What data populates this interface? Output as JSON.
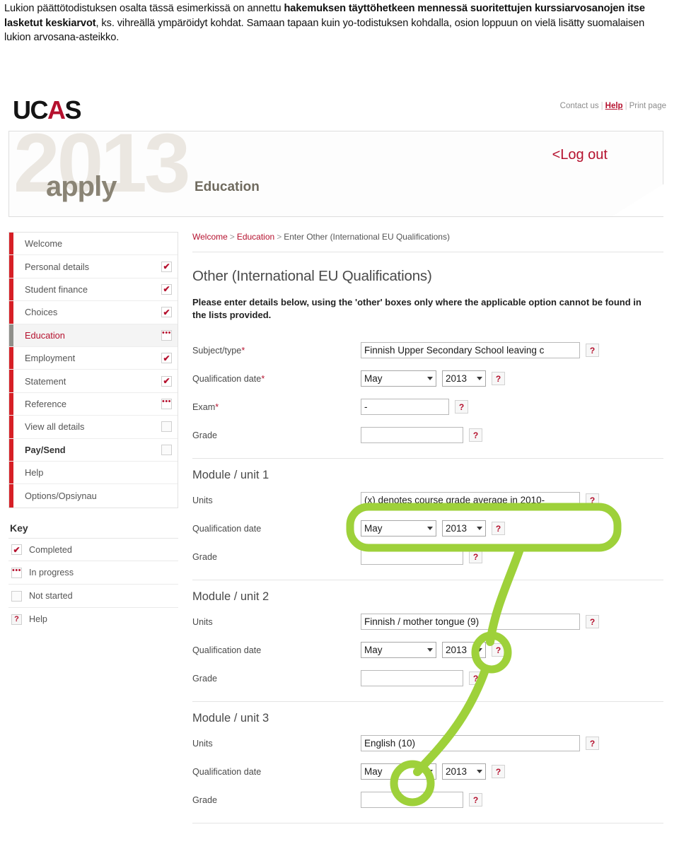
{
  "intro": {
    "segments": [
      {
        "text": "Lukion päättötodistuksen osalta tässä esimerkissä on annettu ",
        "bold": false
      },
      {
        "text": "hakemuksen täyttöhetkeen mennessä suoritettujen kurssiarvosanojen itse lasketut keskiarvot",
        "bold": true
      },
      {
        "text": ", ks. vihreällä ympäröidyt kohdat. Samaan tapaan kuin yo-todistuksen kohdalla, osion loppuun on vielä lisätty suomalaisen lukion arvosana-asteikko.",
        "bold": false
      }
    ],
    "full_text": "Lukion päättötodistuksen osalta tässä esimerkissä on annettu hakemuksen täyttöhetkeen mennessä suoritettujen kurssiarvosanojen itse lasketut keskiarvot, ks. vihreällä ympäröidyt kohdat. Samaan tapaan kuin yo-todistuksen kohdalla, osion loppuun on vielä lisätty suomalaisen lukion arvosana-asteikko."
  },
  "brand": {
    "logo_prefix": "UC",
    "logo_accent": "A",
    "logo_suffix": "S",
    "accent_color": "#b5112e"
  },
  "toplinks": {
    "contact": "Contact us",
    "help": "Help",
    "print": "Print page",
    "separator": "|"
  },
  "banner": {
    "year": "2013",
    "apply": "apply",
    "section": "Education",
    "logout": "<Log out"
  },
  "sidebar": {
    "items": [
      {
        "label": "Welcome",
        "status": "none",
        "active": false,
        "bold": false
      },
      {
        "label": "Personal details",
        "status": "completed",
        "active": false,
        "bold": false
      },
      {
        "label": "Student finance",
        "status": "completed",
        "active": false,
        "bold": false
      },
      {
        "label": "Choices",
        "status": "completed",
        "active": false,
        "bold": false
      },
      {
        "label": "Education",
        "status": "in-progress",
        "active": true,
        "bold": false
      },
      {
        "label": "Employment",
        "status": "completed",
        "active": false,
        "bold": false
      },
      {
        "label": "Statement",
        "status": "completed",
        "active": false,
        "bold": false
      },
      {
        "label": "Reference",
        "status": "in-progress",
        "active": false,
        "bold": false
      },
      {
        "label": "View all details",
        "status": "not-started",
        "active": false,
        "bold": false
      },
      {
        "label": "Pay/Send",
        "status": "not-started",
        "active": false,
        "bold": true
      },
      {
        "label": "Help",
        "status": "none",
        "active": false,
        "bold": false
      },
      {
        "label": "Options/Opsiynau",
        "status": "none",
        "active": false,
        "bold": false
      }
    ]
  },
  "key": {
    "title": "Key",
    "rows": [
      {
        "label": "Completed",
        "status": "completed"
      },
      {
        "label": "In progress",
        "status": "in-progress"
      },
      {
        "label": "Not started",
        "status": "not-started"
      },
      {
        "label": "Help",
        "status": "help"
      }
    ]
  },
  "breadcrumb": {
    "first": "Welcome",
    "second": "Education",
    "current": "Enter Other (International EU Qualifications)",
    "separator": ">"
  },
  "page": {
    "title": "Other (International EU Qualifications)",
    "intro": "Please enter details below, using the 'other' boxes only where the applicable option cannot be found in the lists provided."
  },
  "qualification": {
    "subject_label": "Subject/type",
    "subject_value": "Finnish Upper Secondary School leaving c",
    "date_label": "Qualification date",
    "date_month": "May",
    "date_year": "2013",
    "exam_label": "Exam",
    "exam_value": "-",
    "grade_label": "Grade",
    "grade_value": "",
    "required_marker": "*"
  },
  "modules": [
    {
      "title": "Module / unit 1",
      "units_label": "Units",
      "units_value": "(x) denotes course grade average in 2010-",
      "date_label": "Qualification date",
      "date_month": "May",
      "date_year": "2013",
      "grade_label": "Grade",
      "grade_value": "",
      "highlight": "rounded-box"
    },
    {
      "title": "Module / unit 2",
      "units_label": "Units",
      "units_value": "Finnish / mother tongue (9)",
      "date_label": "Qualification date",
      "date_month": "May",
      "date_year": "2013",
      "grade_label": "Grade",
      "grade_value": "",
      "highlight": "circle-9"
    },
    {
      "title": "Module / unit 3",
      "units_label": "Units",
      "units_value": "English (10)",
      "date_label": "Qualification date",
      "date_month": "May",
      "date_year": "2013",
      "grade_label": "Grade",
      "grade_value": "",
      "highlight": "circle-10"
    }
  ],
  "annotation": {
    "color": "#9ed13a",
    "description": "Green marker highlighting course grade averages"
  },
  "icons": {
    "check": "✔",
    "dots": "•••",
    "help": "?",
    "caret": "▾"
  }
}
